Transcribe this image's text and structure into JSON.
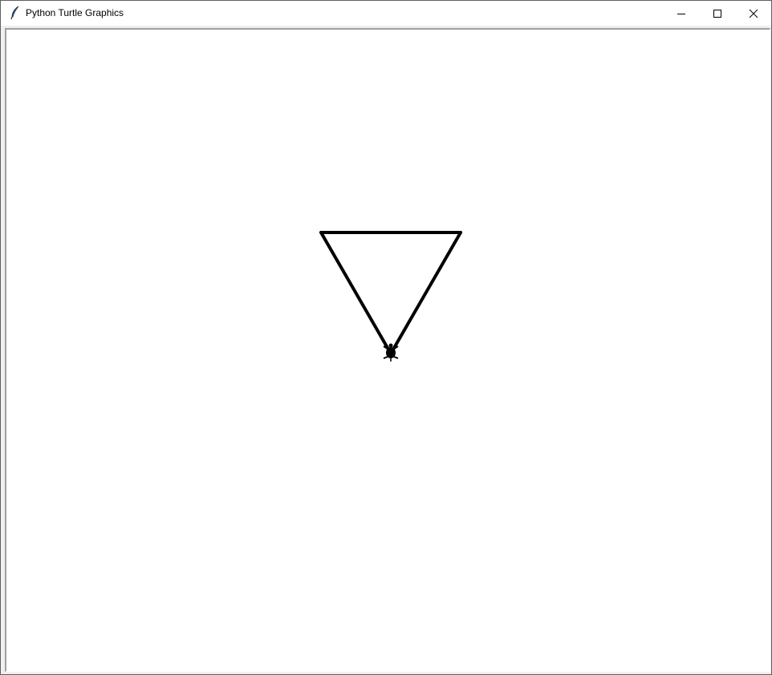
{
  "window": {
    "title": "Python Turtle Graphics",
    "app_icon": "feather-icon",
    "controls": {
      "minimize_icon": "minimize-icon",
      "maximize_icon": "maximize-icon",
      "close_icon": "close-icon"
    }
  },
  "canvas": {
    "background": "#ffffff",
    "pen_color": "#000000",
    "shape": "triangle",
    "turtle_icon": "turtle-icon"
  }
}
